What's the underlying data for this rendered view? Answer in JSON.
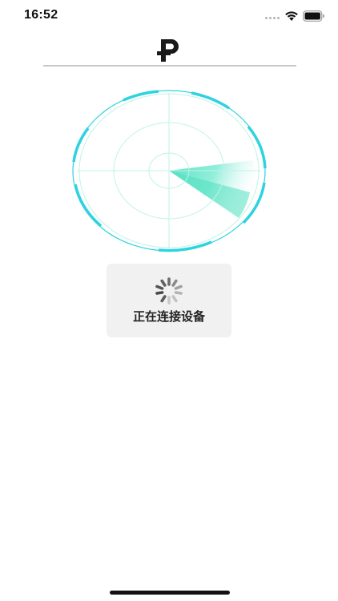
{
  "status_bar": {
    "time": "16:52",
    "wifi_icon": "wifi-icon",
    "battery_icon": "battery-full-icon",
    "signal_icon": "cellular-signal-dots-icon"
  },
  "nav": {
    "logo_icon": "ruble-logo-icon"
  },
  "radar": {
    "icon": "radar-scan-icon",
    "accent_color": "#4fe0c0",
    "ring_color": "#2ed3df",
    "grid_color": "#bff3e6"
  },
  "loading_hud": {
    "spinner_icon": "activity-spinner-icon",
    "label": "正在连接设备"
  },
  "home_indicator": {
    "icon": "home-indicator"
  }
}
